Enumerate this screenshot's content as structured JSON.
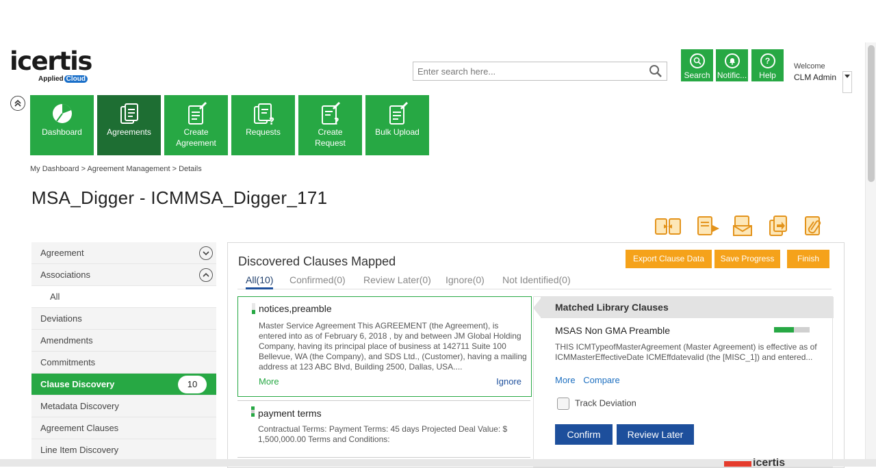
{
  "brand": {
    "name": "icertis",
    "tagline": "Applied",
    "cloud": "Cloud",
    "accent": "#27a844",
    "dark_green": "#1e6e33",
    "blue": "#1d4f9c",
    "orange": "#f5a21a"
  },
  "search": {
    "placeholder": "Enter search here..."
  },
  "top_buttons": [
    {
      "label": "Search",
      "icon": "search-icon"
    },
    {
      "label": "Notific...",
      "icon": "bell-icon"
    },
    {
      "label": "Help",
      "icon": "question-icon"
    }
  ],
  "user": {
    "welcome": "Welcome",
    "name": "CLM Admin"
  },
  "nav_tiles": [
    {
      "label1": "Dashboard",
      "label2": "",
      "icon": "pie-chart-icon"
    },
    {
      "label1": "Agreements",
      "label2": "",
      "icon": "documents-icon"
    },
    {
      "label1": "Create",
      "label2": "Agreement",
      "icon": "create-document-icon"
    },
    {
      "label1": "Requests",
      "label2": "",
      "icon": "requests-icon"
    },
    {
      "label1": "Create",
      "label2": "Request",
      "icon": "create-request-icon"
    },
    {
      "label1": "Bulk Upload",
      "label2": "",
      "icon": "bulk-upload-icon"
    }
  ],
  "breadcrumb": "My Dashboard  >  Agreement Management  >  Details",
  "page_title": "MSA_Digger - ICMMSA_Digger_171",
  "left_nav": {
    "agreement": "Agreement",
    "associations": "Associations",
    "all": "All",
    "deviations": "Deviations",
    "amendments": "Amendments",
    "commitments": "Commitments",
    "clause_discovery": "Clause Discovery",
    "clause_discovery_count": "10",
    "metadata_discovery": "Metadata Discovery",
    "agreement_clauses": "Agreement Clauses",
    "line_item_discovery": "Line Item Discovery"
  },
  "panel": {
    "title": "Discovered Clauses Mapped",
    "export": "Export Clause Data",
    "save": "Save Progress",
    "finish": "Finish",
    "tabs": [
      "All(10)",
      "Confirmed(0)",
      "Review Later(0)",
      "Ignore(0)",
      "Not Identified(0)"
    ]
  },
  "clause1": {
    "title": "notices,preamble",
    "text": "Master Service Agreement This AGREEMENT (the Agreement), is entered into as of February 6, 2018 , by and between JM Global Holding Company, having its principal place of business at 142711 Suite 100 Bellevue, WA (the Company), and SDS Ltd., (Customer), having a mailing address at 123 ABC Blvd, Building 2500, Dallas, USA....",
    "more": "More",
    "ignore": "Ignore"
  },
  "clause2": {
    "title": "payment terms",
    "text": "Contractual Terms: Payment Terms: 45 days Projected Deal Value: $ 1,500,000.00 Terms and Conditions:"
  },
  "matched": {
    "heading": "Matched Library Clauses",
    "title": "MSAS Non GMA Preamble",
    "match_fraction": 0.55,
    "text": "THIS ICMTypeofMasterAgreement (Master Agreement) is effective as of ICMMasterEffectiveDate ICMEffdatevalid (the [MISC_1]) and entered...",
    "more": "More",
    "compare": "Compare",
    "track": "Track Deviation",
    "confirm": "Confirm",
    "review_later": "Review Later"
  },
  "footer": {
    "brand": "icertis"
  }
}
